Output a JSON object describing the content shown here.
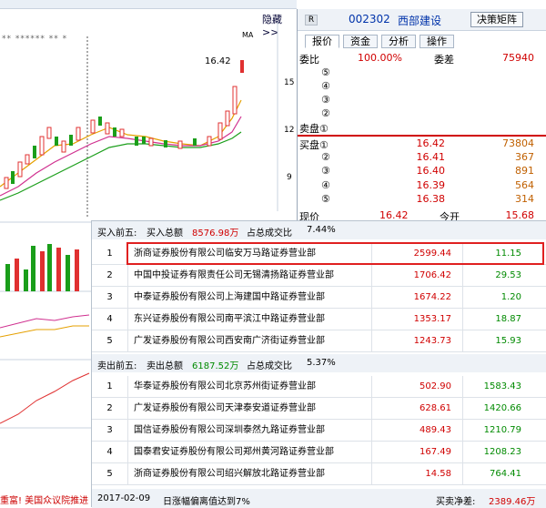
{
  "chart": {
    "hide_label": "隐藏>>",
    "ma_label": "MA",
    "high_label": "16.42",
    "price_ticks": [
      "15",
      "12",
      "9"
    ],
    "marker_text": "** ****** ** *",
    "news": "重富! 美国众议院推进"
  },
  "quote": {
    "badge": "R",
    "code": "002302",
    "name": "西部建设",
    "matrix_button": "决策矩阵",
    "tabs": [
      "报价",
      "资金",
      "分析",
      "操作"
    ],
    "weibi_label": "委比",
    "weibi_value": "100.00%",
    "weicha_label": "委差",
    "weicha_value": "75940",
    "sell_levels": [
      "⑤",
      "④",
      "③",
      "②",
      "卖盘①"
    ],
    "buy_rows": [
      {
        "label": "买盘①",
        "price": "16.42",
        "vol": "73804"
      },
      {
        "label": "②",
        "price": "16.41",
        "vol": "367"
      },
      {
        "label": "③",
        "price": "16.40",
        "vol": "891"
      },
      {
        "label": "④",
        "price": "16.39",
        "vol": "564"
      },
      {
        "label": "⑤",
        "price": "16.38",
        "vol": "314"
      }
    ],
    "last_label": "现价",
    "last_price": "16.42",
    "open_label": "今开",
    "open_value": "15.68"
  },
  "popup": {
    "buy_summary": {
      "title": "买入前五:",
      "total_label": "买入总额",
      "total_value": "8576.98万",
      "ratio_label": "占总成交比",
      "ratio_value": "7.44%"
    },
    "buy_rows": [
      {
        "rank": "1",
        "name": "浙商证券股份有限公司临安万马路证券营业部",
        "amount": "2599.44",
        "pct": "11.15"
      },
      {
        "rank": "2",
        "name": "中国中投证券有限责任公司无锡清扬路证券营业部",
        "amount": "1706.42",
        "pct": "29.53"
      },
      {
        "rank": "3",
        "name": "中泰证券股份有限公司上海建国中路证券营业部",
        "amount": "1674.22",
        "pct": "1.20"
      },
      {
        "rank": "4",
        "name": "东兴证券股份有限公司南平滨江中路证券营业部",
        "amount": "1353.17",
        "pct": "18.87"
      },
      {
        "rank": "5",
        "name": "广发证券股份有限公司西安南广济街证券营业部",
        "amount": "1243.73",
        "pct": "15.93"
      }
    ],
    "sell_summary": {
      "title": "卖出前五:",
      "total_label": "卖出总额",
      "total_value": "6187.52万",
      "ratio_label": "占总成交比",
      "ratio_value": "5.37%"
    },
    "sell_rows": [
      {
        "rank": "1",
        "name": "华泰证券股份有限公司北京苏州街证券营业部",
        "amount": "502.90",
        "pct": "1583.43"
      },
      {
        "rank": "2",
        "name": "广发证券股份有限公司天津泰安道证券营业部",
        "amount": "628.61",
        "pct": "1420.66"
      },
      {
        "rank": "3",
        "name": "国信证券股份有限公司深圳泰然九路证券营业部",
        "amount": "489.43",
        "pct": "1210.79"
      },
      {
        "rank": "4",
        "name": "国泰君安证券股份有限公司郑州黄河路证券营业部",
        "amount": "167.49",
        "pct": "1208.23"
      },
      {
        "rank": "5",
        "name": "浙商证券股份有限公司绍兴解放北路证券营业部",
        "amount": "14.58",
        "pct": "764.41"
      }
    ],
    "footer": {
      "date": "2017-02-09",
      "reason": "日涨幅偏离值达到7%",
      "net_label": "买卖净差:",
      "net_value": "2389.46万"
    }
  },
  "colors": {
    "red": "#d00000",
    "green": "#008a00",
    "blue": "#0033aa",
    "highlight": "#e02020"
  }
}
